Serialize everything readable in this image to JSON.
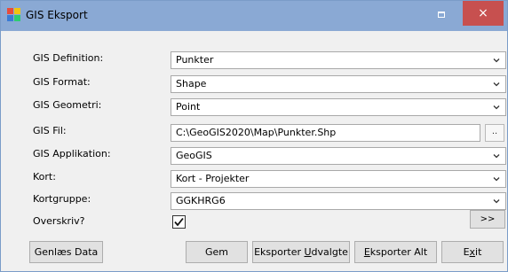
{
  "window": {
    "title": "GIS Eksport",
    "close_glyph": "×",
    "icons": {
      "app": "app-window-icon",
      "minimize": "minimize-icon",
      "close": "close-icon",
      "chevron": "chevron-down-icon",
      "check": "checkmark-icon"
    }
  },
  "form": {
    "rows": [
      {
        "label": "GIS Definition:",
        "value": "Punkter"
      },
      {
        "label": "GIS Format:",
        "value": "Shape"
      },
      {
        "label": "GIS Geometri:",
        "value": "Point"
      },
      {
        "label": "GIS Fil:",
        "value": "C:\\GeoGIS2020\\Map\\Punkter.Shp"
      },
      {
        "label": "GIS Applikation:",
        "value": "GeoGIS"
      },
      {
        "label": "Kort:",
        "value": "Kort - Projekter"
      },
      {
        "label": "Kortgruppe:",
        "value": "GGKHRG6"
      }
    ],
    "overwrite_label": "Overskriv?",
    "overwrite_checked": true,
    "browse_label": "..",
    "expand_label": ">>"
  },
  "buttons": {
    "reload": "Genlæs Data",
    "save": "Gem",
    "export_selected": {
      "before": "Eksporter ",
      "accel": "U",
      "after": "dvalgte"
    },
    "export_all": {
      "before": "",
      "accel": "E",
      "after": "ksporter Alt"
    },
    "exit": {
      "before": "E",
      "accel": "x",
      "after": "it"
    }
  }
}
